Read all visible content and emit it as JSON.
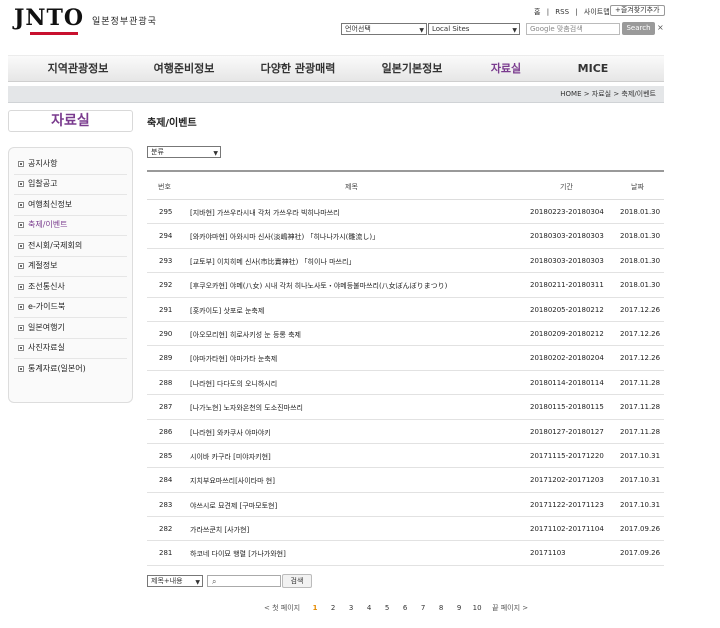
{
  "brand": {
    "logo": "JNTO",
    "subtitle": "일본정부관광국"
  },
  "toplinks": {
    "home": "홈",
    "sep1": "|",
    "rss": "RSS",
    "sep2": "|",
    "sitemap": "사이트맵",
    "favorite": "+즐겨찾기추가"
  },
  "lang_select": "언어선택",
  "local_select": "Local Sites",
  "search": {
    "placeholder": "Google 맞춤검색",
    "button": "Search",
    "clear": "×"
  },
  "gnb": [
    "지역관광정보",
    "여행준비정보",
    "다양한 관광매력",
    "일본기본정보",
    "자료실",
    "MICE"
  ],
  "breadcrumb": "HOME >  자료실 >  축제/이벤트",
  "sidebar": {
    "title": "자료실",
    "items": [
      "공지사항",
      "입찰공고",
      "여행최신정보",
      "축제/이벤트",
      "전시회/국제회의",
      "계절정보",
      "조선통신사",
      "e-가이드북",
      "일본여행기",
      "사진자료실",
      "통계자료(일본어)"
    ],
    "active_index": 3
  },
  "page_title": "축제/이벤트",
  "category_select": "분류",
  "table": {
    "headers": {
      "no": "번호",
      "title": "제목",
      "period": "기간",
      "date": "날짜"
    },
    "rows": [
      {
        "no": "295",
        "title": "[지바현]  가쓰우라시내 각처 가쓰우라 빅히나마쓰리",
        "period": "20180223-20180304",
        "date": "2018.01.30"
      },
      {
        "no": "294",
        "title": "[와카야마현]  아와시마 신사(淡嶋神社) 「히나나가시(雛流し)」",
        "period": "20180303-20180303",
        "date": "2018.01.30"
      },
      {
        "no": "293",
        "title": "[교토부]  이치히메 신사(市比賣神社) 「히이나 마쓰리」",
        "period": "20180303-20180303",
        "date": "2018.01.30"
      },
      {
        "no": "292",
        "title": "[후쿠오카현]  야메(八女) 시내 각처 히나노사토・야메등불마쓰리(八女ぼんぼりまつり)",
        "period": "20180211-20180311",
        "date": "2018.01.30"
      },
      {
        "no": "291",
        "title": "[홋카이도] 삿포로 눈축제",
        "period": "20180205-20180212",
        "date": "2017.12.26"
      },
      {
        "no": "290",
        "title": "[아오모리현] 히로사키성 눈 등롱 축제",
        "period": "20180209-20180212",
        "date": "2017.12.26"
      },
      {
        "no": "289",
        "title": "[야마가타현] 야마가타 눈축제",
        "period": "20180202-20180204",
        "date": "2017.12.26"
      },
      {
        "no": "288",
        "title": "[나라현] 다다도의 오니하시리",
        "period": "20180114-20180114",
        "date": "2017.11.28"
      },
      {
        "no": "287",
        "title": "[나가노현] 노자와온천의 도소진마쓰리",
        "period": "20180115-20180115",
        "date": "2017.11.28"
      },
      {
        "no": "286",
        "title": "[나라현] 와카쿠사 야마야키",
        "period": "20180127-20180127",
        "date": "2017.11.28"
      },
      {
        "no": "285",
        "title": "시이바 카구라 [미야자키현]",
        "period": "20171115-20171220",
        "date": "2017.10.31"
      },
      {
        "no": "284",
        "title": "지치부요마쓰리[사이타마 현]",
        "period": "20171202-20171203",
        "date": "2017.10.31"
      },
      {
        "no": "283",
        "title": "야쓰시로 묘견제  [구마모토현]",
        "period": "20171122-20171123",
        "date": "2017.10.31"
      },
      {
        "no": "282",
        "title": "가라쓰쿤치 [사가현]",
        "period": "20171102-20171104",
        "date": "2017.09.26"
      },
      {
        "no": "281",
        "title": "하코네 다이묘 행렬 [가나가와현]",
        "period": "20171103",
        "date": "2017.09.26"
      }
    ]
  },
  "filter": {
    "select": "제목+내용",
    "button": "검색"
  },
  "pager": {
    "prev": "< 첫 페이지",
    "pages": [
      "1",
      "2",
      "3",
      "4",
      "5",
      "6",
      "7",
      "8",
      "9",
      "10"
    ],
    "current": "1",
    "next": "끝 페이지 >"
  }
}
